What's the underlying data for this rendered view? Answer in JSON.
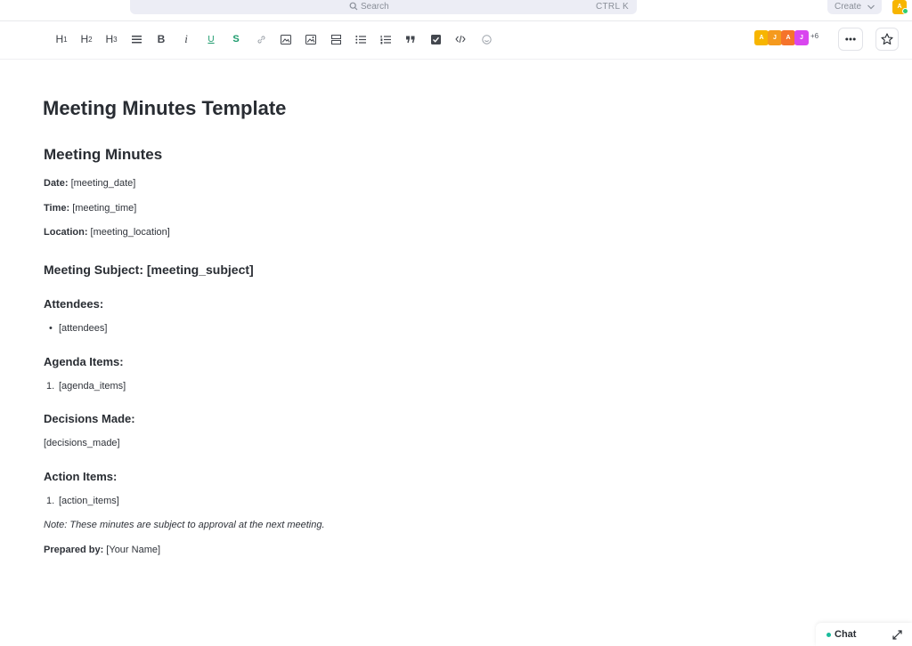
{
  "topbar": {
    "search_placeholder": "Search",
    "search_shortcut": "CTRL K",
    "create_label": "Create",
    "user_avatar_initial": "A"
  },
  "toolbar": {
    "h1_label": "H",
    "h1_level": "1",
    "h2_label": "H",
    "h2_level": "2",
    "h3_label": "H",
    "h3_level": "3",
    "bold_label": "B",
    "italic_label": "i",
    "underline_label": "U",
    "strike_label": "S"
  },
  "collaborators": {
    "avatars": [
      {
        "initial": "A",
        "color": "#f7b500"
      },
      {
        "initial": "J",
        "color": "#f59a1e"
      },
      {
        "initial": "A",
        "color": "#f5732b"
      },
      {
        "initial": "J",
        "color": "#d946ef"
      }
    ],
    "more_count": "+6"
  },
  "document": {
    "title": "Meeting Minutes Template",
    "heading": "Meeting Minutes",
    "date_label": "Date:",
    "date_value": " [meeting_date]",
    "time_label": "Time:",
    "time_value": " [meeting_time]",
    "location_label": "Location:",
    "location_value": " [meeting_location]",
    "subject_heading": "Meeting Subject: [meeting_subject]",
    "attendees_heading": "Attendees:",
    "attendees_item": "[attendees]",
    "agenda_heading": "Agenda Items:",
    "agenda_item": "[agenda_items]",
    "decisions_heading": "Decisions Made:",
    "decisions_value": "[decisions_made]",
    "actions_heading": "Action Items:",
    "actions_item": "[action_items]",
    "note": "Note: These minutes are subject to approval at the next meeting.",
    "prepared_label": "Prepared by:",
    "prepared_value": " [Your Name]"
  },
  "chat": {
    "label": "Chat"
  },
  "colors": {
    "accent_teal": "#1abc9c",
    "avatar_yellow": "#f7b500"
  }
}
